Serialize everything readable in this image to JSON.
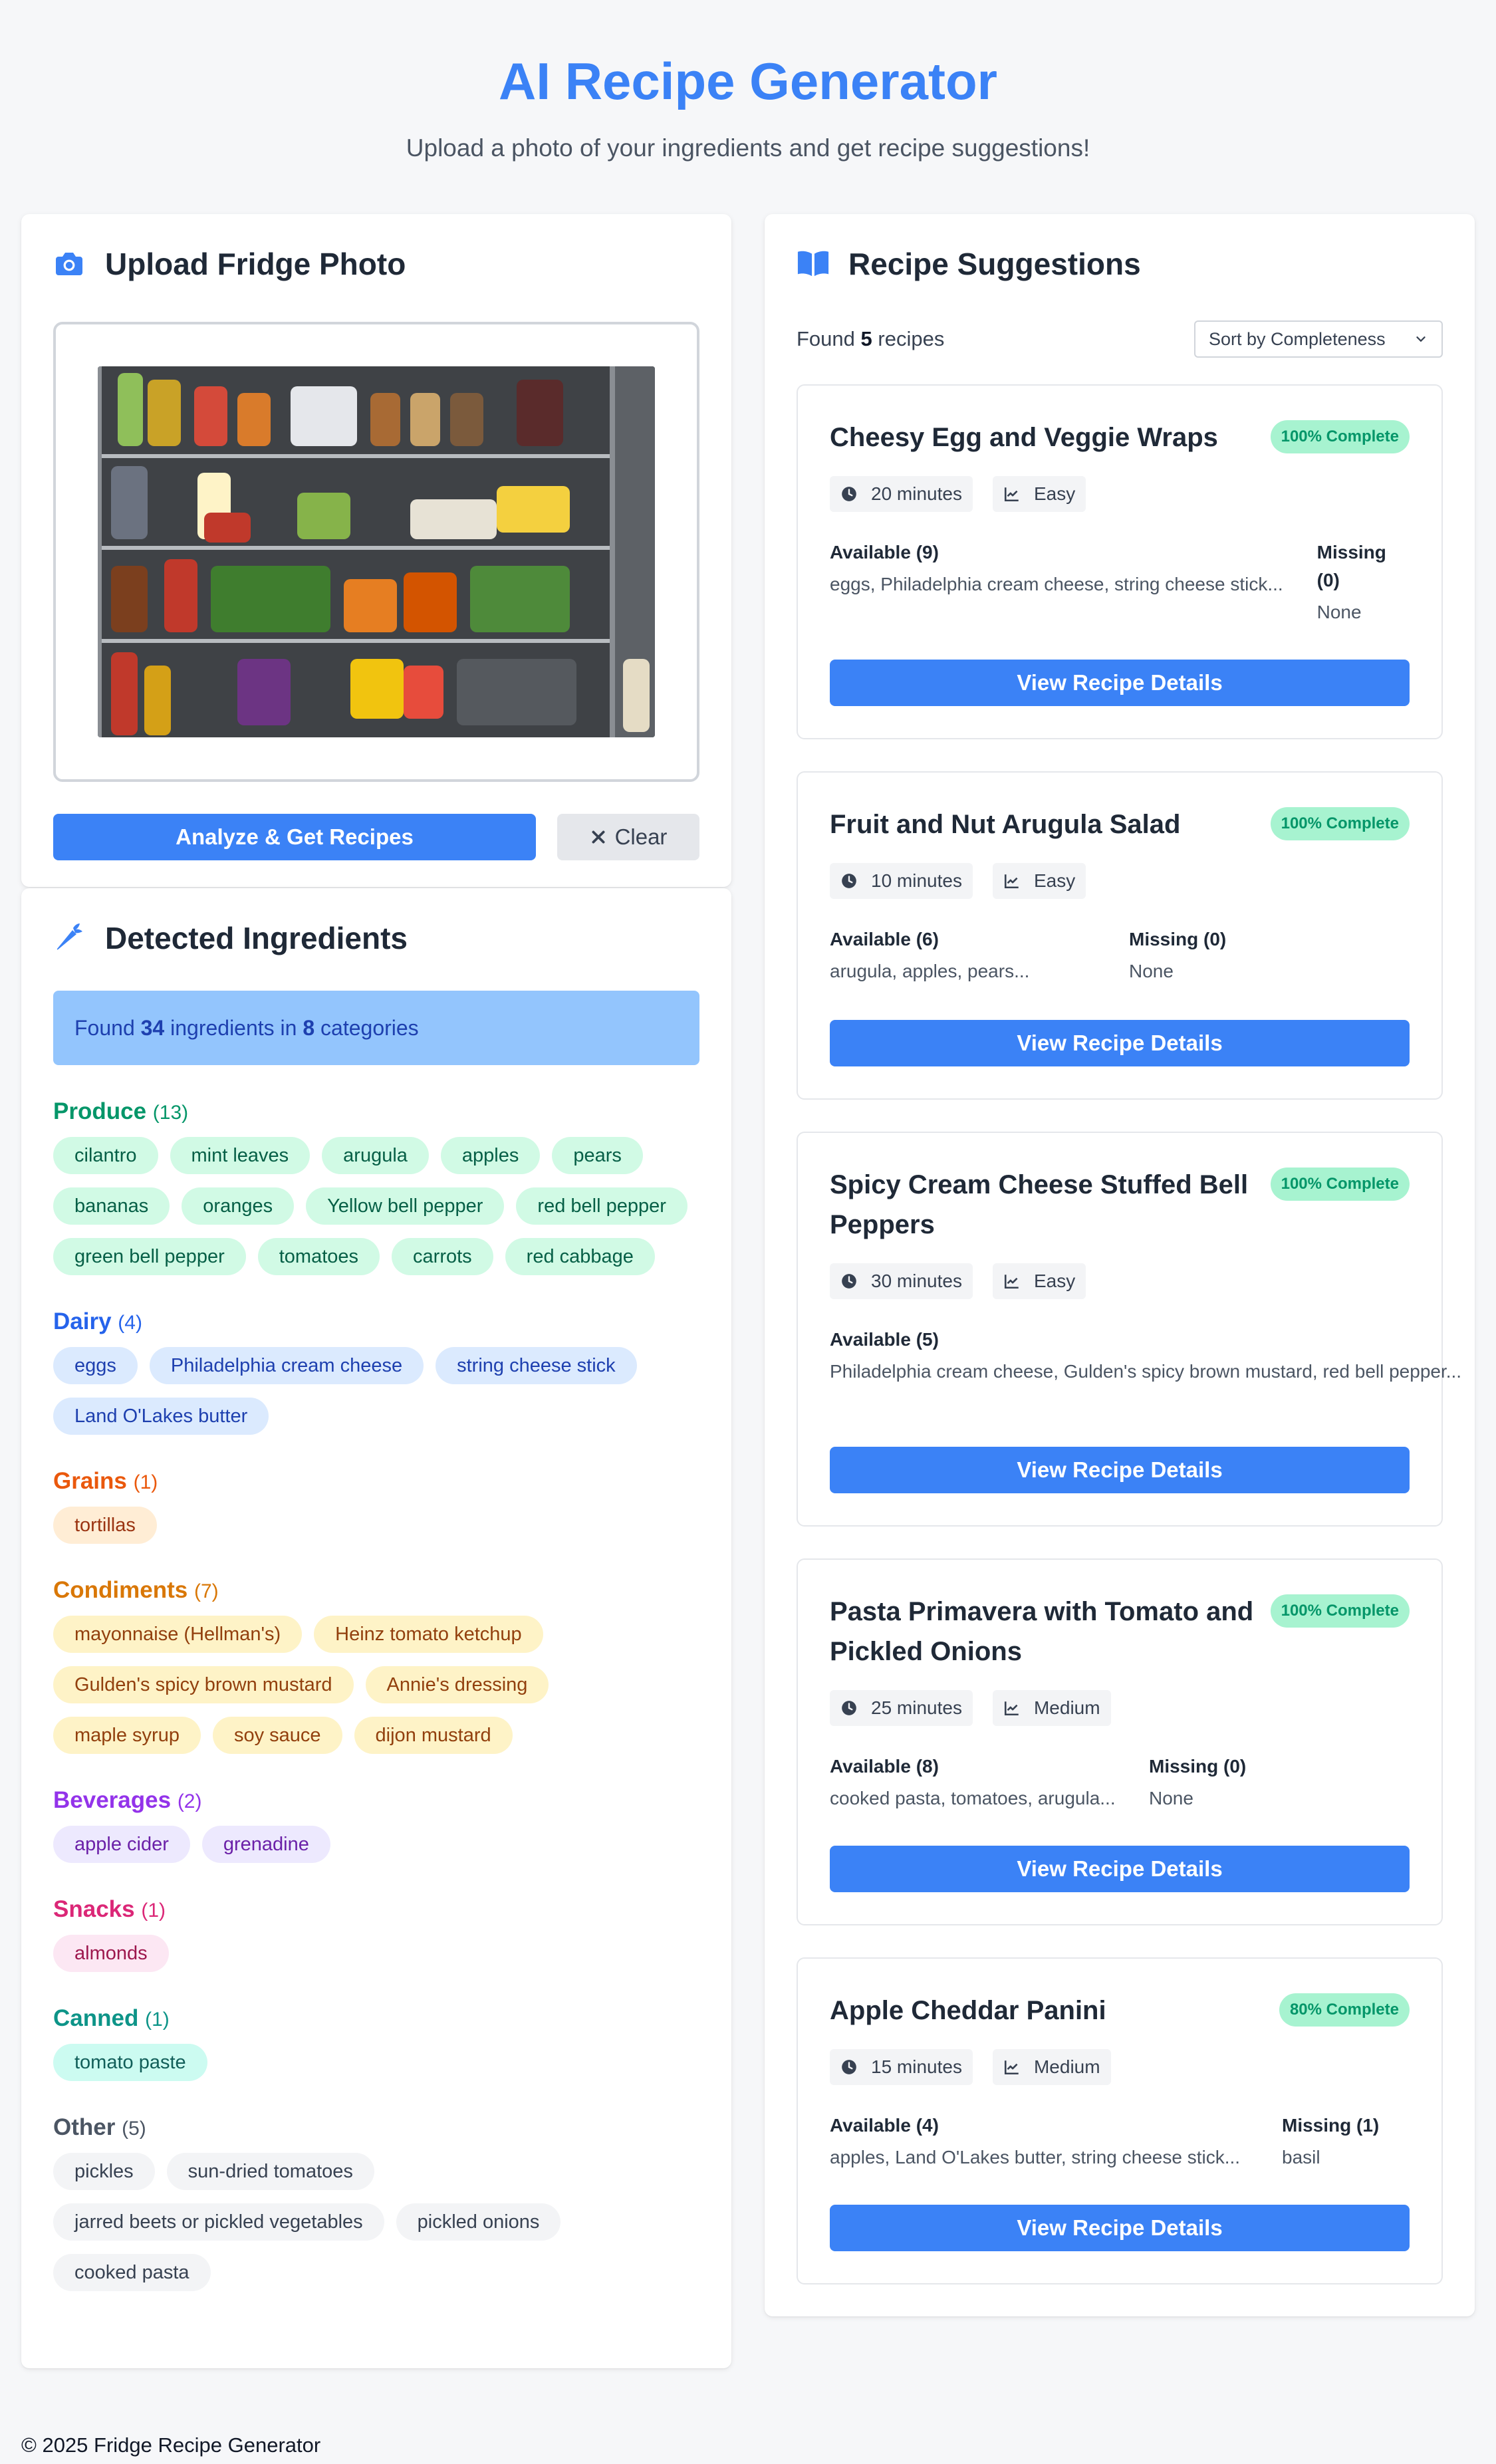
{
  "header": {
    "title": "AI Recipe Generator",
    "subtitle": "Upload a photo of your ingredients and get recipe suggestions!"
  },
  "upload": {
    "title": "Upload Fridge Photo",
    "analyze_label": "Analyze & Get Recipes",
    "clear_label": "Clear"
  },
  "ingredients": {
    "title": "Detected Ingredients",
    "found_prefix": "Found",
    "found_count": "34",
    "found_mid": "ingredients in",
    "found_categories": "8",
    "found_suffix": "categories",
    "categories": [
      {
        "name": "Produce",
        "count": "(13)",
        "color": "#059669",
        "chip_bg": "#d1fae5",
        "chip_fg": "#065f46",
        "items": [
          "cilantro",
          "mint leaves",
          "arugula",
          "apples",
          "pears",
          "bananas",
          "oranges",
          "Yellow bell pepper",
          "red bell pepper",
          "green bell pepper",
          "tomatoes",
          "carrots",
          "red cabbage"
        ]
      },
      {
        "name": "Dairy",
        "count": "(4)",
        "color": "#2563eb",
        "chip_bg": "#dbeafe",
        "chip_fg": "#1e40af",
        "items": [
          "eggs",
          "Philadelphia cream cheese",
          "string cheese stick",
          "Land O'Lakes butter"
        ]
      },
      {
        "name": "Grains",
        "count": "(1)",
        "color": "#ea580c",
        "chip_bg": "#ffedd5",
        "chip_fg": "#9a3412",
        "items": [
          "tortillas"
        ]
      },
      {
        "name": "Condiments",
        "count": "(7)",
        "color": "#d97706",
        "chip_bg": "#fef3c7",
        "chip_fg": "#92400e",
        "items": [
          "mayonnaise (Hellman's)",
          "Heinz tomato ketchup",
          "Gulden's spicy brown mustard",
          "Annie's dressing",
          "maple syrup",
          "soy sauce",
          "dijon mustard"
        ]
      },
      {
        "name": "Beverages",
        "count": "(2)",
        "color": "#9333ea",
        "chip_bg": "#ede9fe",
        "chip_fg": "#6b21a8",
        "items": [
          "apple cider",
          "grenadine"
        ]
      },
      {
        "name": "Snacks",
        "count": "(1)",
        "color": "#db2777",
        "chip_bg": "#fce7f3",
        "chip_fg": "#9d174d",
        "items": [
          "almonds"
        ]
      },
      {
        "name": "Canned",
        "count": "(1)",
        "color": "#0d9488",
        "chip_bg": "#ccfbf1",
        "chip_fg": "#115e59",
        "items": [
          "tomato paste"
        ]
      },
      {
        "name": "Other",
        "count": "(5)",
        "color": "#4b5563",
        "chip_bg": "#f3f4f6",
        "chip_fg": "#374151",
        "items": [
          "pickles",
          "sun-dried tomatoes",
          "jarred beets or pickled vegetables",
          "pickled onions",
          "cooked pasta"
        ]
      }
    ]
  },
  "recipes": {
    "title": "Recipe Suggestions",
    "found_prefix": "Found",
    "found_count": "5",
    "found_suffix": "recipes",
    "sort_label": "Sort by Completeness",
    "view_label": "View Recipe Details",
    "items": [
      {
        "name": "Cheesy Egg and Veggie Wraps",
        "complete": "100% Complete",
        "time": "20 minutes",
        "difficulty": "Easy",
        "available_label": "Available (9)",
        "available": "eggs, Philadelphia cream cheese, string cheese stick...",
        "missing_label": "Missing (0)",
        "missing": "None"
      },
      {
        "name": "Fruit and Nut Arugula Salad",
        "complete": "100% Complete",
        "time": "10 minutes",
        "difficulty": "Easy",
        "available_label": "Available (6)",
        "available": "arugula, apples, pears...",
        "missing_label": "Missing (0)",
        "missing": "None"
      },
      {
        "name": "Spicy Cream Cheese Stuffed Bell Peppers",
        "complete": "100% Complete",
        "time": "30 minutes",
        "difficulty": "Easy",
        "available_label": "Available (5)",
        "available": "Philadelphia cream cheese, Gulden's spicy brown mustard, red bell pepper...",
        "missing_label": "",
        "missing": ""
      },
      {
        "name": "Pasta Primavera with Tomato and Pickled Onions",
        "complete": "100% Complete",
        "time": "25 minutes",
        "difficulty": "Medium",
        "available_label": "Available (8)",
        "available": "cooked pasta, tomatoes, arugula...",
        "missing_label": "Missing (0)",
        "missing": "None"
      },
      {
        "name": "Apple Cheddar Panini",
        "complete": "80% Complete",
        "time": "15 minutes",
        "difficulty": "Medium",
        "available_label": "Available (4)",
        "available": "apples, Land O'Lakes butter, string cheese stick...",
        "missing_label": "Missing (1)",
        "missing": "basil"
      }
    ]
  },
  "footer": {
    "text": "© 2025 Fridge Recipe Generator"
  },
  "colors": {
    "accent": "#3b82f6",
    "badge_bg": "#a7f3d0",
    "badge_fg": "#059669"
  },
  "icons": {
    "upload": "camera-icon",
    "ingredients": "carrot-icon",
    "recipes": "book-open-icon",
    "clear": "close-icon",
    "time": "clock-icon",
    "difficulty": "chart-line-icon",
    "sort": "chevron-down-icon"
  }
}
